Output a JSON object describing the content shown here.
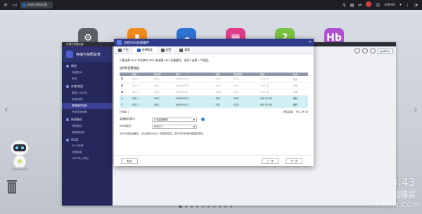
{
  "taskbar": {
    "tab_title": "存储与快照总管",
    "user": "admin",
    "user_caret": "▾"
  },
  "desktop": {
    "clock": "23:43",
    "watermark": "SMZDM.COM",
    "watermark_glyph": "值",
    "icon_colors": [
      "#5b5f66",
      "#f28a1b",
      "#2e74d4",
      "#e03c8a",
      "#7ac142",
      "#b04fd1"
    ],
    "icon_glyphs": [
      "⚙",
      "▮",
      "☁",
      "▦",
      "?",
      "Hb"
    ]
  },
  "storage_manager": {
    "window_title": "存储与快照总管",
    "app_name": "存储与快照总管",
    "sections": [
      {
        "title": "概述",
        "items": [
          "存储空间",
          "系统"
        ]
      },
      {
        "title": "存储/快照",
        "items": [
          "磁盘 / VJBOD",
          "存储/快照",
          "高速缓存加速",
          "外部存储设备"
        ]
      },
      {
        "title": "快照备份",
        "items": [
          "快照复制",
          "快照保险库"
        ]
      },
      {
        "title": "iSCSI",
        "items": [
          "iSCSI存储",
          "远程磁盘",
          "LUN 导入/导出"
        ]
      }
    ],
    "active_item": "高速缓存加速",
    "right_select": "以/ISCSI"
  },
  "dialog": {
    "title": "创建SSD高速缓存",
    "close": "✕",
    "steps": [
      "介绍",
      "选择磁盘",
      "配置",
      "摘要"
    ],
    "active_step": 1,
    "description": "只能选择 NAS 中安装的 SSD 来创建 SSD 高速缓存。请至少选择一个磁盘。",
    "subheading": "选择所配置磁盘：",
    "table": {
      "headers": [
        "",
        "磁盘",
        "制造商",
        "型号",
        "类型",
        "总线类型",
        "容量",
        "状态"
      ],
      "rows": [
        {
          "selected": false,
          "cells": [
            "",
            "Disk 1",
            "WDC",
            "WD60EFRX",
            "HDD",
            "SATA",
            "5.46 TB",
            "就绪"
          ]
        },
        {
          "selected": false,
          "cells": [
            "",
            "Disk 2",
            "WDC",
            "WD60EFRX",
            "HDD",
            "SATA",
            "5.46 TB",
            "就绪"
          ]
        },
        {
          "selected": false,
          "cells": [
            "",
            "Disk 3",
            "WDC",
            "WD60EFRX",
            "HDD",
            "SATA",
            "5.46 TB",
            "就绪"
          ]
        },
        {
          "selected": true,
          "cells": [
            "☑",
            "SSD 1",
            "WDC",
            "WDS500G2...",
            "SSD",
            "SATA",
            "465.76 GB",
            "良好"
          ]
        },
        {
          "selected": true,
          "cells": [
            "☑",
            "SSD 2",
            "WDC",
            "WDS500G2...",
            "SSD",
            "SATA",
            "465.76 GB",
            "良好"
          ]
        }
      ]
    },
    "selected_count": "已选择: 2",
    "estimated_capacity": "预估容量：  931.29 GB",
    "cache_mode_label": "高速缓存模式:",
    "cache_mode_value": "只读高速缓存",
    "raid_label": "RAID类型:",
    "raid_value": "RAID 0",
    "info_icon": "i",
    "note": "对于只读高速缓存，可以使用 RAID 0 来提高性能，因为不存在丢失数据的风险。",
    "buttons": {
      "cancel": "取消",
      "prev": "上一步",
      "next": "下一步"
    }
  }
}
